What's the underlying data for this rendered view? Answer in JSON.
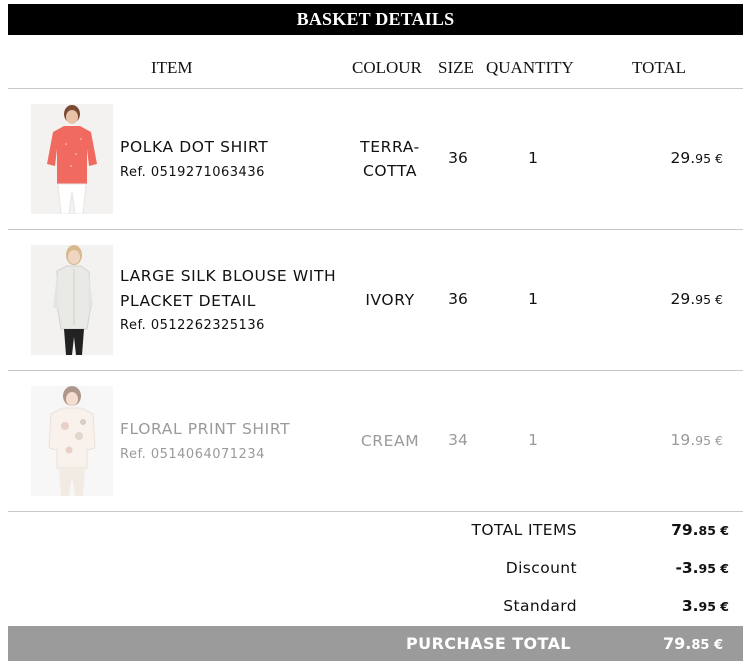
{
  "header": {
    "title": "BASKET DETAILS"
  },
  "columns": {
    "item": "ITEM",
    "colour": "COLOUR",
    "size": "SIZE",
    "quantity": "QUANTITY",
    "total": "TOTAL"
  },
  "items": [
    {
      "name_line1": "POLKA DOT SHIRT",
      "name_line2": "",
      "ref": "Ref. 0519271063436",
      "colour_line1": "TERRA-",
      "colour_line2": "COTTA",
      "size": "36",
      "quantity": "1",
      "price_whole": "29.",
      "price_cents": "95 €",
      "image_icon": "coral-shirt-model-image"
    },
    {
      "name_line1": "LARGE SILK BLOUSE WITH",
      "name_line2": "PLACKET DETAIL",
      "ref": "Ref. 0512262325136",
      "colour_line1": "IVORY",
      "colour_line2": "",
      "size": "36",
      "quantity": "1",
      "price_whole": "29.",
      "price_cents": "95 €",
      "image_icon": "ivory-blouse-model-image"
    },
    {
      "name_line1": "FLORAL PRINT SHIRT",
      "name_line2": "",
      "ref": "Ref. 0514064071234",
      "colour_line1": "CREAM",
      "colour_line2": "",
      "size": "34",
      "quantity": "1",
      "price_whole": "19.",
      "price_cents": "95 €",
      "image_icon": "floral-shirt-model-image"
    }
  ],
  "summary": {
    "total_items_label": "TOTAL ITEMS",
    "total_items_whole": "79.",
    "total_items_cents": "85 €",
    "discount_label": "Discount",
    "discount_whole": "-3.",
    "discount_cents": "95 €",
    "shipping_label": "Standard",
    "shipping_whole": "3.",
    "shipping_cents": "95 €",
    "purchase_total_label": "PURCHASE TOTAL",
    "purchase_total_whole": "79.",
    "purchase_total_cents": "85 €"
  },
  "colors": {
    "title_bg": "#000000",
    "purchase_bar_bg": "#9b9b9b",
    "coral_shirt": "#f06a5f",
    "faded_text": "#9a9a9a"
  }
}
